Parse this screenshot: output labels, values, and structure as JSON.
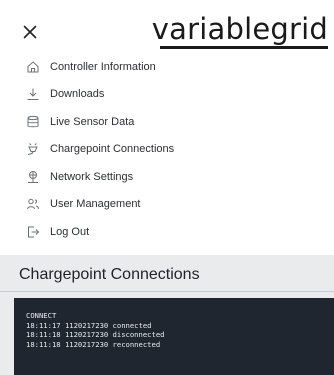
{
  "header": {
    "logo_text": "variablegrid"
  },
  "nav": {
    "items": [
      {
        "label": "Controller Information",
        "icon": "home-icon"
      },
      {
        "label": "Downloads",
        "icon": "download-icon"
      },
      {
        "label": "Live Sensor Data",
        "icon": "database-icon"
      },
      {
        "label": "Chargepoint Connections",
        "icon": "plug-icon"
      },
      {
        "label": "Network Settings",
        "icon": "network-icon"
      },
      {
        "label": "User Management",
        "icon": "users-icon"
      },
      {
        "label": "Log Out",
        "icon": "logout-icon"
      }
    ]
  },
  "main": {
    "title": "Chargepoint Connections",
    "console_lines": [
      "CONNECT",
      "18:11:17 1120217230 connected",
      "18:11:18 1120217230 disconnected",
      "18:11:18 1120217230 reconnected"
    ]
  },
  "colors": {
    "console_bg": "#1f2630",
    "page_bg": "#e9ebed",
    "drawer_bg": "#ffffff"
  }
}
